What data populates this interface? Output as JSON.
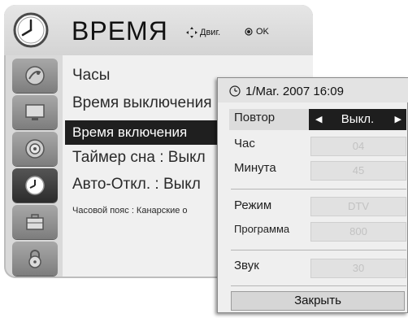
{
  "header": {
    "title": "ВРЕМЯ",
    "hint_move": "Двиг.",
    "hint_ok": "OK"
  },
  "sidebar": {
    "items": [
      {
        "icon": "satellite-dish-icon"
      },
      {
        "icon": "monitor-icon"
      },
      {
        "icon": "speaker-icon"
      },
      {
        "icon": "clock-icon",
        "active": true
      },
      {
        "icon": "briefcase-icon"
      },
      {
        "icon": "lock-icon"
      }
    ]
  },
  "menu": {
    "items": [
      "Часы",
      "Время выключения",
      "Время включения",
      "Таймер сна : Выкл",
      "Авто-Откл. : Выкл",
      "Часовой пояс : Канарские о"
    ]
  },
  "popup": {
    "datetime": "1/Mar. 2007 16:09",
    "repeat_label": "Повтор",
    "repeat_value": "Выкл.",
    "hour_label": "Час",
    "hour_value": "04",
    "minute_label": "Минута",
    "minute_value": "45",
    "mode_label": "Режим",
    "mode_value": "DTV",
    "program_label": "Программа",
    "program_value": "800",
    "sound_label": "Звук",
    "sound_value": "30",
    "close_label": "Закрыть"
  },
  "colors": {
    "selected": "#1f1f1f",
    "panel": "#efefef",
    "disabled_text": "#c2c2c2"
  }
}
